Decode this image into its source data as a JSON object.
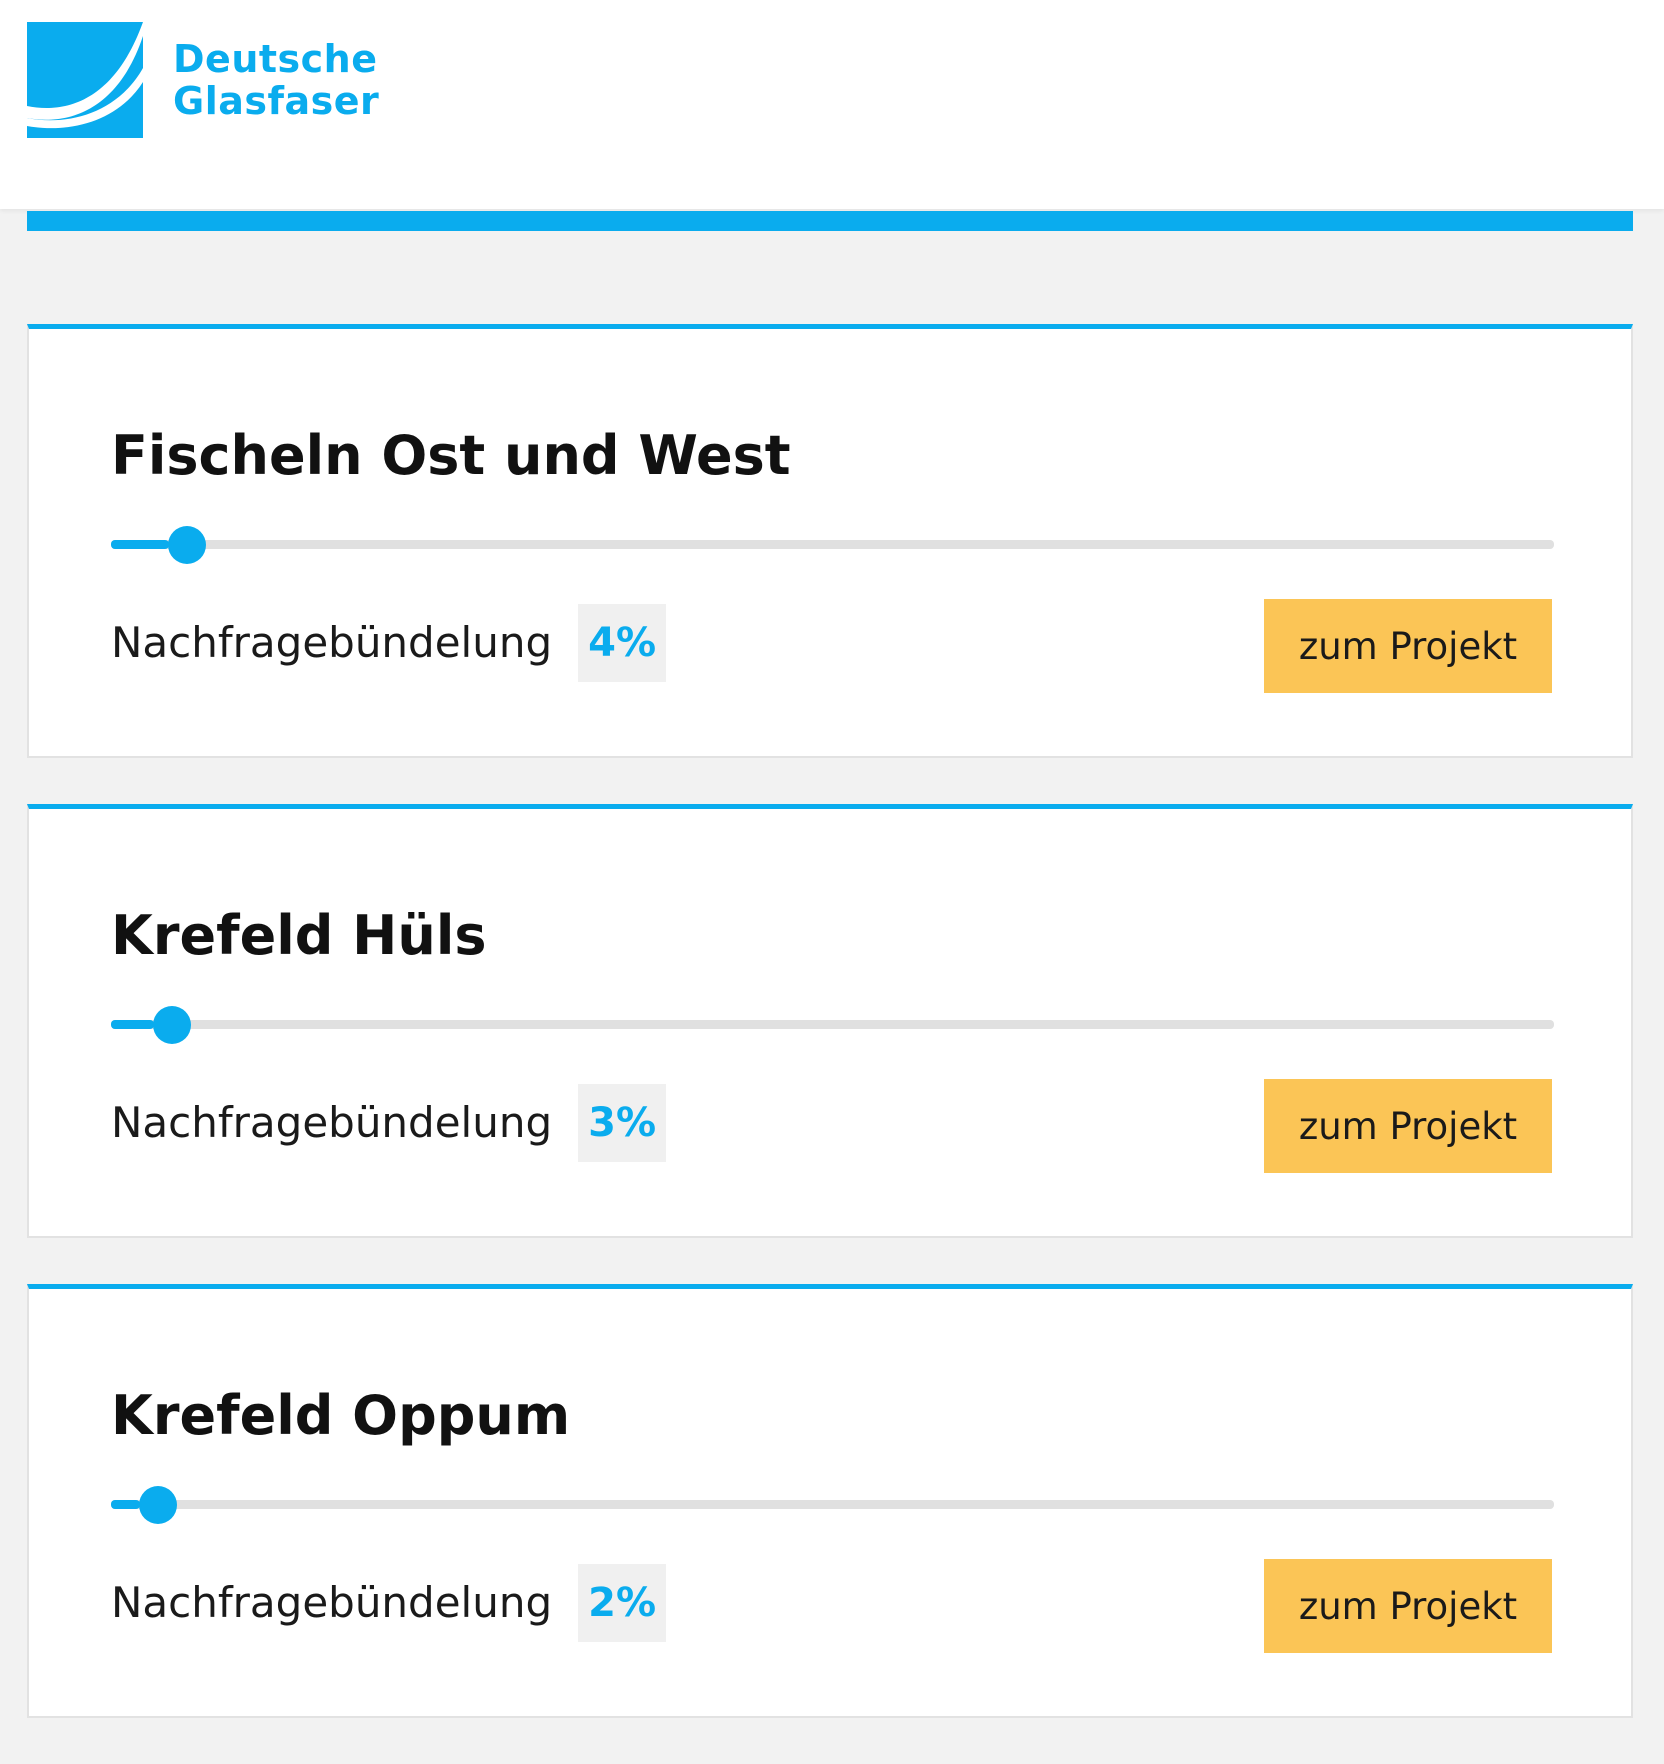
{
  "brand": {
    "line1": "Deutsche",
    "line2": "Glasfaser",
    "accent_color": "#0aacee",
    "button_color": "#fbc556"
  },
  "projects": [
    {
      "title": "Fischeln Ost und West",
      "label": "Nachfragebündelung",
      "percent_text": "4%",
      "progress_fraction": 0.04,
      "button_label": "zum Projekt"
    },
    {
      "title": "Krefeld Hüls",
      "label": "Nachfragebündelung",
      "percent_text": "3%",
      "progress_fraction": 0.03,
      "button_label": "zum Projekt"
    },
    {
      "title": "Krefeld Oppum",
      "label": "Nachfragebündelung",
      "percent_text": "2%",
      "progress_fraction": 0.02,
      "button_label": "zum Projekt"
    }
  ]
}
